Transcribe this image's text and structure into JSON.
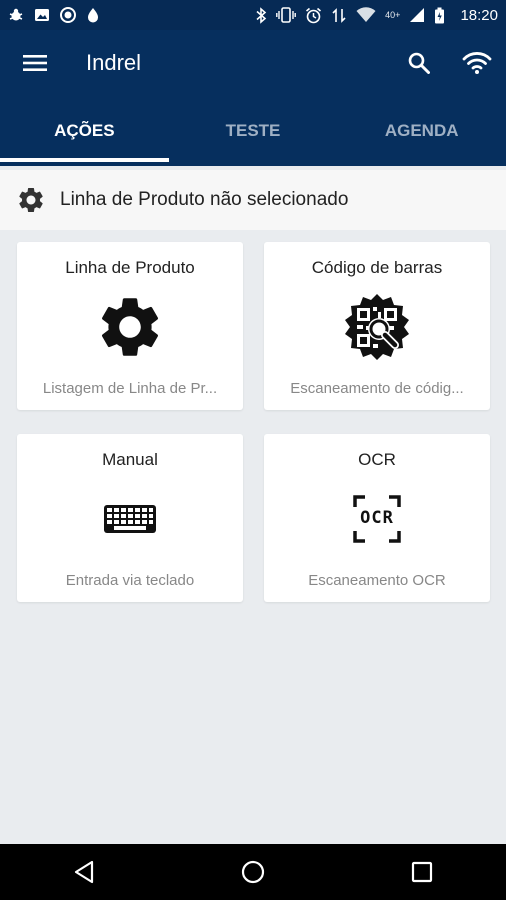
{
  "status_bar": {
    "time": "18:20",
    "network_badge": "40+"
  },
  "app_bar": {
    "title": "Indrel"
  },
  "tabs": [
    {
      "label": "AÇÕES"
    },
    {
      "label": "TESTE"
    },
    {
      "label": "AGENDA"
    }
  ],
  "product_line_header": {
    "text": "Linha de Produto não selecionado"
  },
  "cards": [
    {
      "title": "Linha de Produto",
      "subtitle": "Listagem de Linha de Pr..."
    },
    {
      "title": "Código de barras",
      "subtitle": "Escaneamento de códig..."
    },
    {
      "title": "Manual",
      "subtitle": "Entrada via teclado"
    },
    {
      "title": "OCR",
      "subtitle": "Escaneamento OCR",
      "icon_text": "OCR"
    }
  ]
}
